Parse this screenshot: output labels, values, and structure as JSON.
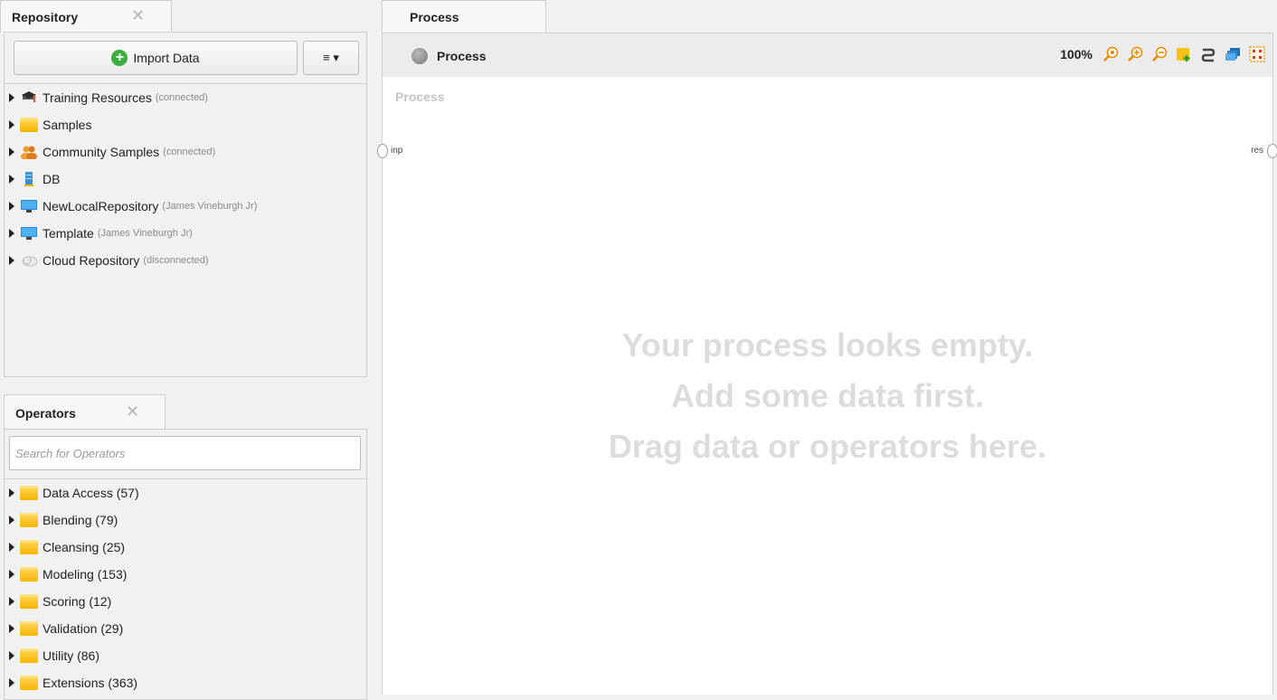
{
  "repository": {
    "tab_label": "Repository",
    "close_glyph": "✕",
    "import_label": "Import Data",
    "menu_glyph": "≡ ▾",
    "items": [
      {
        "label": "Training Resources",
        "note": "(connected)"
      },
      {
        "label": "Samples",
        "note": ""
      },
      {
        "label": "Community Samples",
        "note": "(connected)"
      },
      {
        "label": "DB",
        "note": ""
      },
      {
        "label": "NewLocalRepository",
        "note": "(James Vineburgh Jr)"
      },
      {
        "label": "Template",
        "note": "(James Vineburgh Jr)"
      },
      {
        "label": "Cloud Repository",
        "note": "(disconnected)"
      }
    ]
  },
  "operators": {
    "tab_label": "Operators",
    "close_glyph": "✕",
    "search_placeholder": "Search for Operators",
    "items": [
      {
        "label": "Data Access (57)"
      },
      {
        "label": "Blending (79)"
      },
      {
        "label": "Cleansing (25)"
      },
      {
        "label": "Modeling (153)"
      },
      {
        "label": "Scoring (12)"
      },
      {
        "label": "Validation (29)"
      },
      {
        "label": "Utility (86)"
      },
      {
        "label": "Extensions (363)"
      }
    ]
  },
  "process": {
    "tab_label": "Process",
    "toolbar_title": "Process",
    "zoom": "100%",
    "canvas_label": "Process",
    "port_in": "inp",
    "port_out": "res",
    "empty_lines": [
      "Your process looks empty.",
      "Add some data first.",
      "Drag data or operators here."
    ]
  },
  "colors": {
    "accent_green": "#3cae3f",
    "folder_yellow": "#f4b400",
    "empty_text": "#dcdcdc"
  }
}
